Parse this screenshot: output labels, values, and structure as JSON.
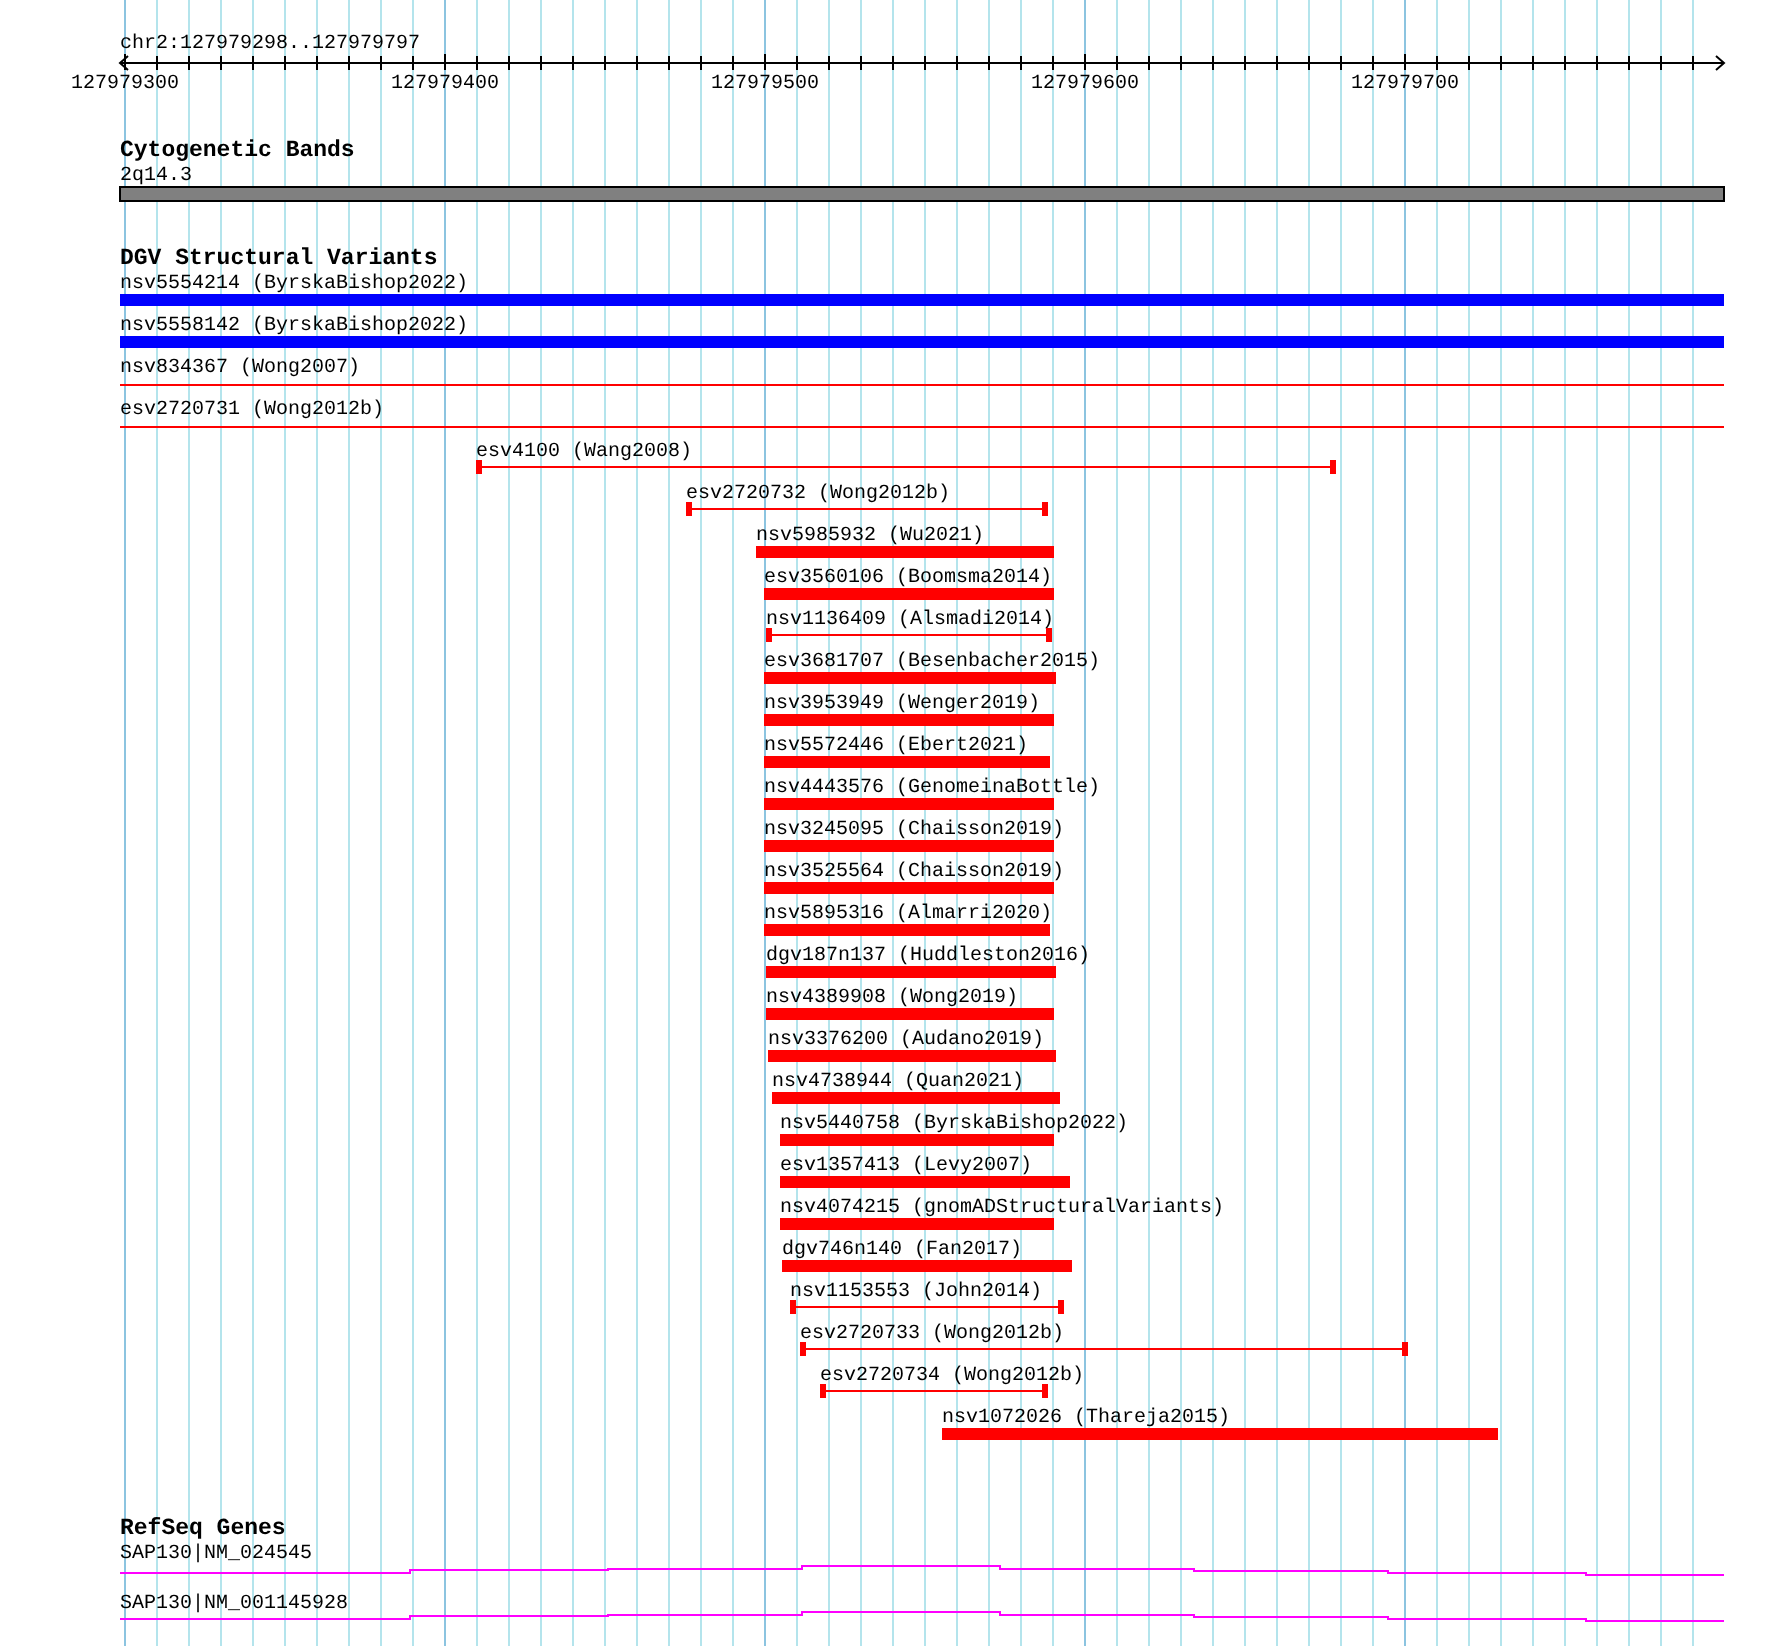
{
  "ruler": {
    "title": "chr2:127979298..127979797",
    "labels": [
      "127979300",
      "127979400",
      "127979500",
      "127979600",
      "127979700"
    ]
  },
  "cytoband": {
    "title": "Cytogenetic Bands",
    "features": [
      {
        "label": "2q14.3"
      }
    ]
  },
  "dgv": {
    "title": "DGV Structural Variants",
    "features": [
      {
        "label": "nsv5554214 (ByrskaBishop2022)",
        "kind": "bar",
        "color": "#0000ff"
      },
      {
        "label": "nsv5558142 (ByrskaBishop2022)",
        "kind": "bar",
        "color": "#0000ff"
      },
      {
        "label": "nsv834367 (Wong2007)",
        "kind": "line",
        "color": "#ff0000"
      },
      {
        "label": "esv2720731 (Wong2012b)",
        "kind": "line",
        "color": "#ff0000"
      },
      {
        "label": "esv4100 (Wang2008)",
        "kind": "span",
        "color": "#ff0000"
      },
      {
        "label": "esv2720732 (Wong2012b)",
        "kind": "span",
        "color": "#ff0000"
      },
      {
        "label": "nsv5985932 (Wu2021)",
        "kind": "bar",
        "color": "#ff0000"
      },
      {
        "label": "esv3560106 (Boomsma2014)",
        "kind": "bar",
        "color": "#ff0000"
      },
      {
        "label": "nsv1136409 (Alsmadi2014)",
        "kind": "span",
        "color": "#ff0000"
      },
      {
        "label": "esv3681707 (Besenbacher2015)",
        "kind": "bar",
        "color": "#ff0000"
      },
      {
        "label": "nsv3953949 (Wenger2019)",
        "kind": "bar",
        "color": "#ff0000"
      },
      {
        "label": "nsv5572446 (Ebert2021)",
        "kind": "bar",
        "color": "#ff0000"
      },
      {
        "label": "nsv4443576 (GenomeinaBottle)",
        "kind": "bar",
        "color": "#ff0000"
      },
      {
        "label": "nsv3245095 (Chaisson2019)",
        "kind": "bar",
        "color": "#ff0000"
      },
      {
        "label": "nsv3525564 (Chaisson2019)",
        "kind": "bar",
        "color": "#ff0000"
      },
      {
        "label": "nsv5895316 (Almarri2020)",
        "kind": "bar",
        "color": "#ff0000"
      },
      {
        "label": "dgv187n137 (Huddleston2016)",
        "kind": "bar",
        "color": "#ff0000"
      },
      {
        "label": "nsv4389908 (Wong2019)",
        "kind": "bar",
        "color": "#ff0000"
      },
      {
        "label": "nsv3376200 (Audano2019)",
        "kind": "bar",
        "color": "#ff0000"
      },
      {
        "label": "nsv4738944 (Quan2021)",
        "kind": "bar",
        "color": "#ff0000"
      },
      {
        "label": "nsv5440758 (ByrskaBishop2022)",
        "kind": "bar",
        "color": "#ff0000"
      },
      {
        "label": "esv1357413 (Levy2007)",
        "kind": "bar",
        "color": "#ff0000"
      },
      {
        "label": "nsv4074215 (gnomADStructuralVariants)",
        "kind": "bar",
        "color": "#ff0000"
      },
      {
        "label": "dgv746n140 (Fan2017)",
        "kind": "bar",
        "color": "#ff0000"
      },
      {
        "label": "nsv1153553 (John2014)",
        "kind": "span",
        "color": "#ff0000"
      },
      {
        "label": "esv2720733 (Wong2012b)",
        "kind": "span",
        "color": "#ff0000"
      },
      {
        "label": "esv2720734 (Wong2012b)",
        "kind": "span",
        "color": "#ff0000"
      },
      {
        "label": "nsv1072026 (Thareja2015)",
        "kind": "bar",
        "color": "#ff0000"
      }
    ]
  },
  "refseq": {
    "title": "RefSeq Genes",
    "features": [
      {
        "label": "SAP130|NM_024545"
      },
      {
        "label": "SAP130|NM_001145928"
      }
    ]
  }
}
